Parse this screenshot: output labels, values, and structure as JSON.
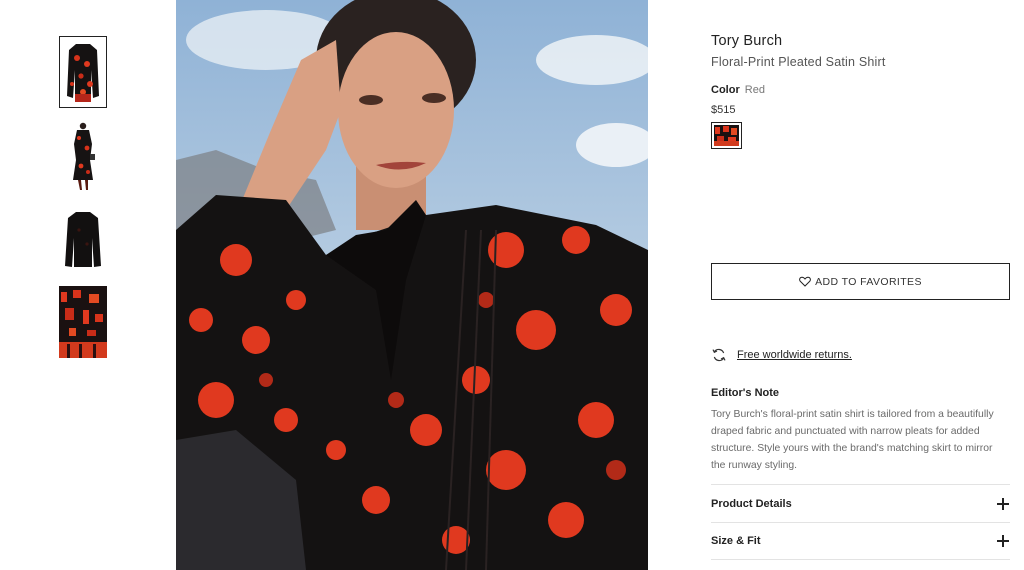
{
  "product": {
    "brand": "Tory Burch",
    "name": "Floral-Print Pleated Satin Shirt",
    "color_label": "Color",
    "color_value": "Red",
    "price": "$515"
  },
  "gallery": {
    "thumbnails": [
      "thumbnail-front-flat",
      "thumbnail-runway-look",
      "thumbnail-back-flat",
      "thumbnail-fabric-detail"
    ],
    "main_image": "model-wearing-shirt"
  },
  "actions": {
    "favorites_label": "ADD TO FAVORITES",
    "returns_label": "Free worldwide returns."
  },
  "editors_note": {
    "title": "Editor's Note",
    "text": "Tory Burch's floral-print satin shirt is tailored from a beautifully draped fabric and punctuated with narrow pleats for added structure. Style yours with the brand's matching skirt to mirror the runway styling."
  },
  "accordions": [
    {
      "label": "Product Details"
    },
    {
      "label": "Size & Fit"
    }
  ],
  "colors": {
    "accent": "#222222",
    "print_red": "#e0391f",
    "shirt_black": "#141212",
    "sky": "#a9c3de"
  }
}
